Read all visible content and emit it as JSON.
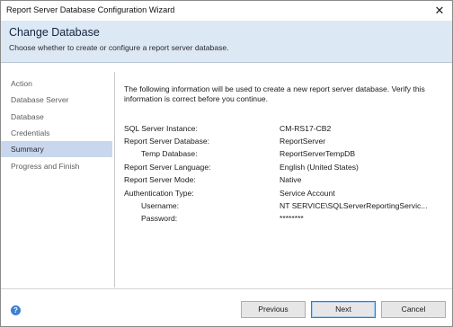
{
  "window": {
    "title": "Report Server Database Configuration Wizard",
    "close_glyph": "✕"
  },
  "header": {
    "title": "Change Database",
    "subtitle": "Choose whether to create or configure a report server database."
  },
  "sidebar": {
    "items": [
      {
        "label": "Action"
      },
      {
        "label": "Database Server"
      },
      {
        "label": "Database"
      },
      {
        "label": "Credentials"
      },
      {
        "label": "Summary",
        "selected": true
      },
      {
        "label": "Progress and Finish"
      }
    ]
  },
  "summary": {
    "intro": "The following information will be used to create a new report server database. Verify this information is correct before you continue.",
    "rows": [
      {
        "label": "SQL Server Instance:",
        "value": "CM-RS17-CB2"
      },
      {
        "label": "Report Server Database:",
        "value": "ReportServer"
      },
      {
        "label": "Temp Database:",
        "value": "ReportServerTempDB"
      },
      {
        "label": "Report Server Language:",
        "value": "English (United States)"
      },
      {
        "label": "Report Server Mode:",
        "value": "Native"
      },
      {
        "label": "Authentication Type:",
        "value": "Service Account"
      },
      {
        "label": "Username:",
        "value": "NT SERVICE\\SQLServerReportingServic..."
      },
      {
        "label": "Password:",
        "value": "********"
      }
    ]
  },
  "footer": {
    "help_glyph": "?",
    "previous_label": "Previous",
    "next_label": "Next",
    "cancel_label": "Cancel"
  }
}
